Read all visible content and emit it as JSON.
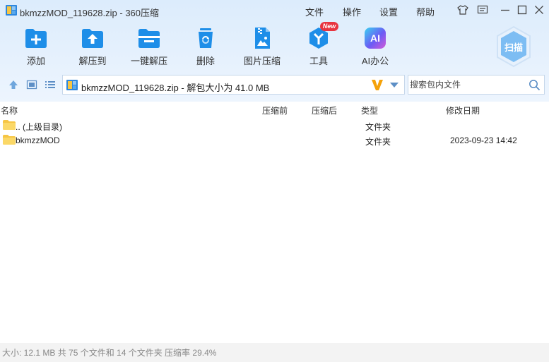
{
  "window": {
    "title": "bkmzzMOD_119628.zip - 360压缩",
    "menu": [
      "文件",
      "操作",
      "设置",
      "帮助"
    ]
  },
  "toolbar": {
    "items": [
      {
        "label": "添加",
        "icon": "add-icon"
      },
      {
        "label": "解压到",
        "icon": "extract-to-icon"
      },
      {
        "label": "一键解压",
        "icon": "one-click-extract-icon"
      },
      {
        "label": "删除",
        "icon": "delete-icon"
      },
      {
        "label": "图片压缩",
        "icon": "image-compress-icon"
      },
      {
        "label": "工具",
        "icon": "tools-icon",
        "badge": "New"
      },
      {
        "label": "AI办公",
        "icon": "ai-office-icon",
        "icon_text": "AI"
      }
    ],
    "scan_label": "扫描"
  },
  "address": {
    "path": "bkmzzMOD_119628.zip - 解包大小为 41.0 MB"
  },
  "search": {
    "placeholder": "搜索包内文件"
  },
  "columns": {
    "name": "名称",
    "compressed_before": "压缩前",
    "compressed_after": "压缩后",
    "type": "类型",
    "modified": "修改日期"
  },
  "rows": [
    {
      "name": ".. (上级目录)",
      "type": "文件夹",
      "date": ""
    },
    {
      "name": "bkmzzMOD",
      "type": "文件夹",
      "date": "2023-09-23 14:42"
    }
  ],
  "status": {
    "text": "大小: 12.1 MB 共 75 个文件和 14 个文件夹 压缩率 29.4%"
  },
  "colors": {
    "accent_blue": "#1e8ee8",
    "folder_yellow": "#f6c544",
    "badge_red": "#e8343f",
    "orange_v": "#f5a20a"
  }
}
